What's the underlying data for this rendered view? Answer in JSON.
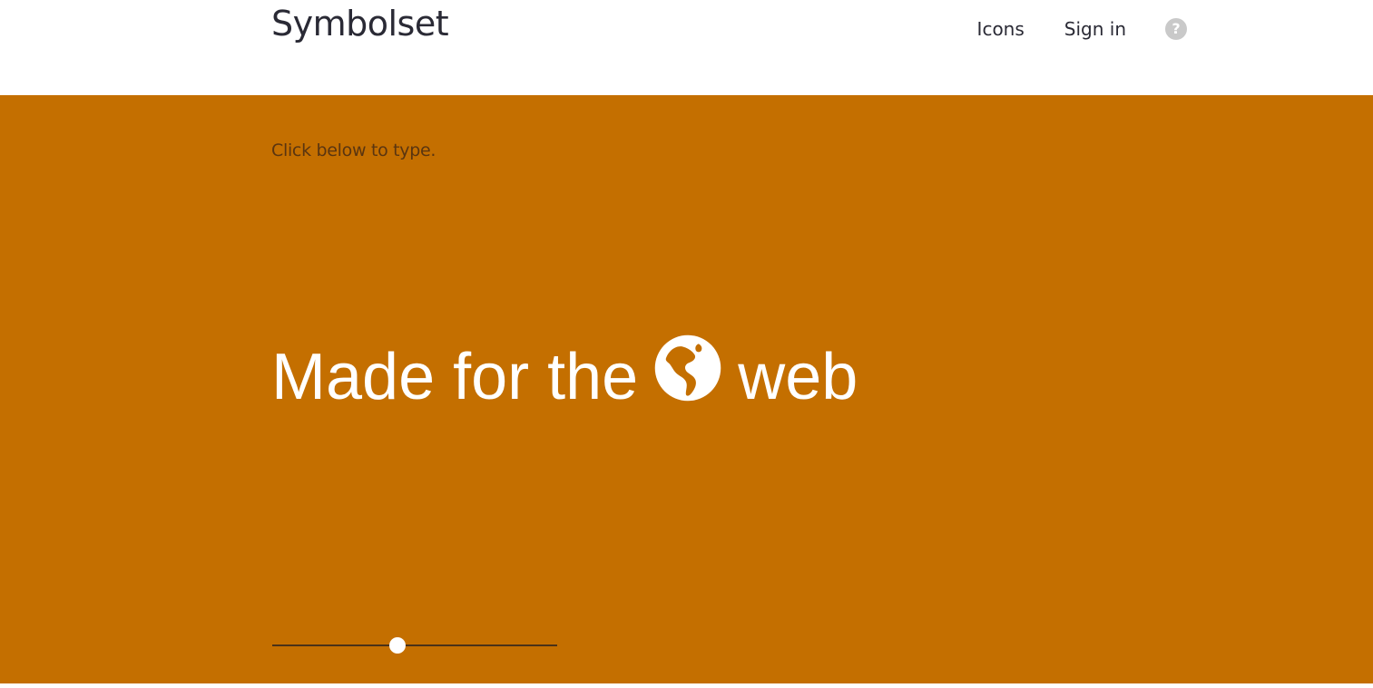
{
  "header": {
    "logo": "Symbolset",
    "nav": {
      "icons_label": "Icons",
      "signin_label": "Sign in",
      "help_label": "?"
    }
  },
  "hero": {
    "instruction": "Click below to type.",
    "headline": {
      "before": "Made for the",
      "icon": "globe-icon",
      "after": "web"
    },
    "size_slider": {
      "value_fraction": 0.44
    },
    "colors": {
      "background": "#c46f00",
      "text": "#ffffff"
    }
  }
}
